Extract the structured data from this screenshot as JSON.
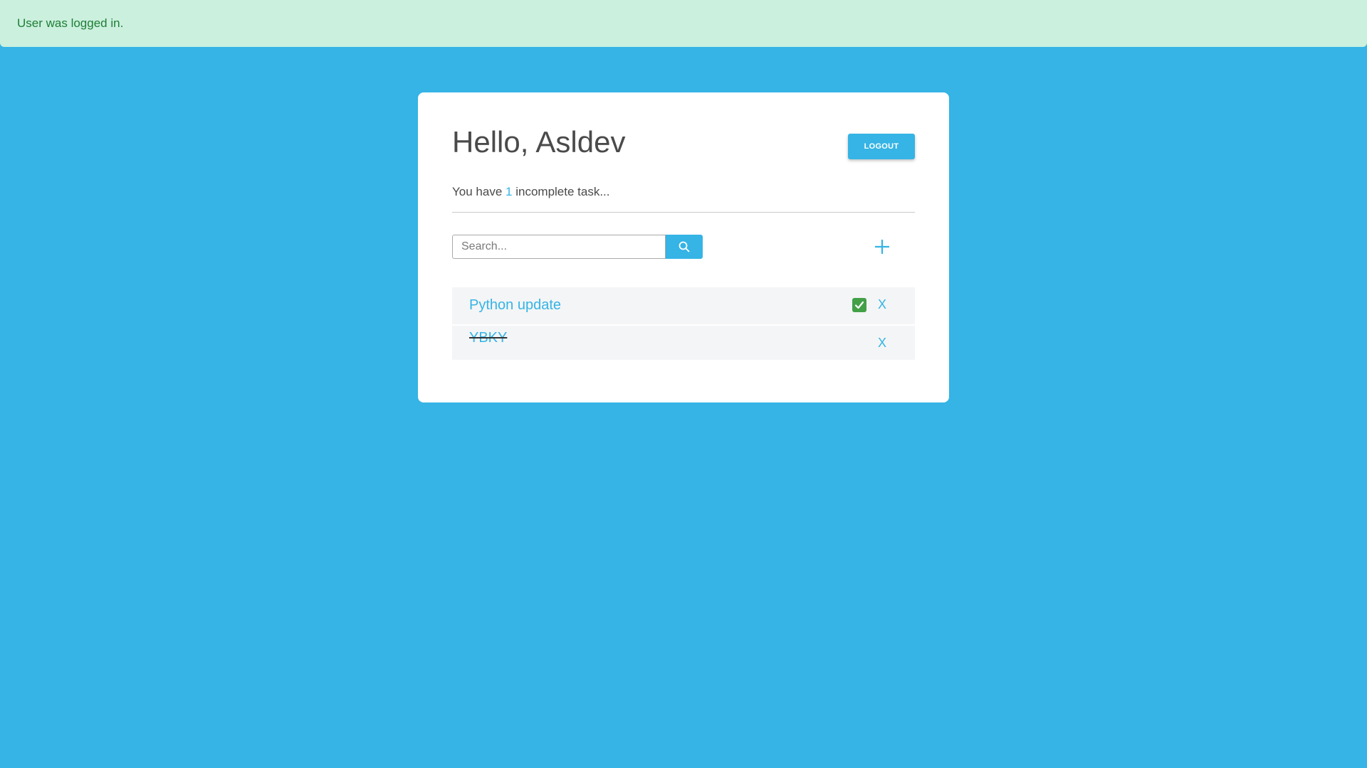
{
  "alert": {
    "message": "User was logged in."
  },
  "header": {
    "greeting": "Hello,",
    "username": "Asldev",
    "logout_label": "LOGOUT"
  },
  "summary": {
    "prefix": "You have",
    "count": "1",
    "suffix": "incomplete task..."
  },
  "search": {
    "placeholder": "Search...",
    "value": ""
  },
  "tasks": [
    {
      "title": "Python update",
      "completed": false,
      "delete_label": "X"
    },
    {
      "title": "YBKY",
      "completed": true,
      "delete_label": "X"
    }
  ],
  "colors": {
    "background": "#35b4e5",
    "accent": "#35b4e5",
    "alert_bg": "#cbf0de",
    "alert_text": "#1e7e34",
    "check_green": "#43a047"
  },
  "icons": {
    "search": "search-icon",
    "add": "plus-icon",
    "complete": "check-icon"
  }
}
